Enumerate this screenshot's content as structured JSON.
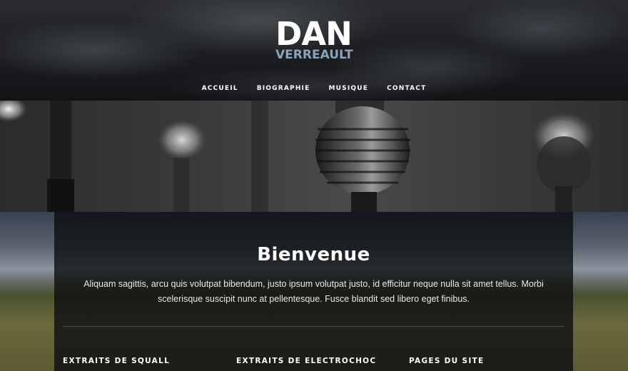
{
  "logo": {
    "main": "DAN",
    "sub": "VERREAULT"
  },
  "nav": {
    "items": [
      "ACCUEIL",
      "BIOGRAPHIE",
      "MUSIQUE",
      "CONTACT"
    ]
  },
  "welcome": {
    "title": "Bienvenue",
    "text": "Aliquam sagittis, arcu quis volutpat bibendum, justo ipsum volutpat justo, id efficitur neque nulla sit amet tellus. Morbi scelerisque suscipit nunc at pellentesque. Fusce blandit sed libero eget finibus."
  },
  "footer": {
    "headings": [
      "EXTRAITS DE SQUALL",
      "EXTRAITS DE ELECTROCHOC",
      "PAGES DU SITE"
    ]
  },
  "colors": {
    "logo_sub": "#8aa3ba",
    "panel": "#0a0b0e"
  }
}
